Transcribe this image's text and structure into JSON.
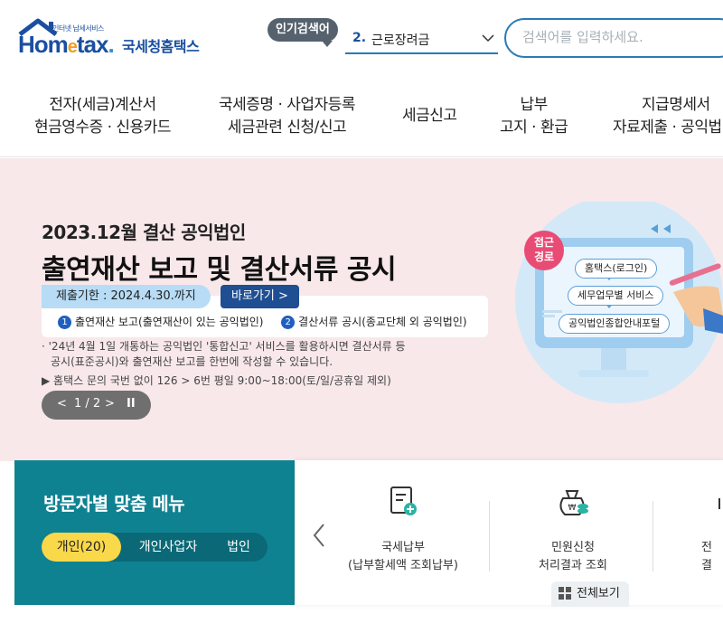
{
  "header": {
    "logo_small": "인터넷 납세서비스",
    "logo_main_1": "Hom",
    "logo_main_e": "e",
    "logo_main_2": "tax",
    "logo_kr": "국세청홈택스",
    "popular_label": "인기검색어",
    "popular_rank": "2.",
    "popular_keyword": "근로장려금",
    "search_placeholder": "검색어를 입력하세요."
  },
  "nav": [
    {
      "line1": "전자(세금)계산서",
      "line2": "현금영수증 · 신용카드"
    },
    {
      "line1": "국세증명 · 사업자등록",
      "line2": "세금관련 신청/신고"
    },
    {
      "line1": "세금신고",
      "line2": ""
    },
    {
      "line1": "납부",
      "line2": "고지 · 환급"
    },
    {
      "line1": "지급명세서",
      "line2": "자료제출 · 공익법"
    }
  ],
  "banner": {
    "subtitle": "2023.12월 결산 공익법인",
    "title": "출연재산 보고 및 결산서류 공시",
    "deadline": "제출기한 : 2024.4.30.까지",
    "go_button": "바로가기 >",
    "item1_num": "1",
    "item1": "출연재산 보고(출연재산이 있는 공익법인)",
    "item2_num": "2",
    "item2": "결산서류 공시(종교단체 외 공익법인)",
    "note_line1": "· '24년 4월 1일 개통하는 공익법인 '통합신고' 서비스를 활용하시면 결산서류 등",
    "note_line2": "  공시(표준공시)와 출연재산 보고를 한번에 작성할 수 있습니다.",
    "note_phone": "▶ 홈택스 문의 국번 없이 126 > 6번 평일 9:00~18:00(토/일/공휴일 제외)",
    "pager_prev": "<",
    "pager_text": "1 / 2",
    "pager_next": ">",
    "pager_pause": "II",
    "illus_badge_1": "접근",
    "illus_badge_2": "경로",
    "illus_step1": "홈택스(로그인)",
    "illus_step2": "세무업무별 서비스",
    "illus_step3": "공익법인종합안내포털"
  },
  "visitor": {
    "title": "방문자별 맞춤 메뉴",
    "tabs": [
      "개인(20)",
      "개인사업자",
      "법인"
    ],
    "active_tab": "개인(20)"
  },
  "quick": {
    "items": [
      {
        "line1": "국세납부",
        "line2": "(납부할세액 조회납부)",
        "icon": "tax-payment-document-icon"
      },
      {
        "line1": "민원신청",
        "line2": "처리결과 조회",
        "icon": "money-bag-coins-icon"
      },
      {
        "line1": "전",
        "line2": "결",
        "icon": "partial-icon"
      }
    ],
    "view_all": "전체보기"
  },
  "colors": {
    "brand_blue": "#1a4fa0",
    "banner_bg": "#f8e8ea",
    "visitor_bg": "#0f8292",
    "active_tab": "#f9d84a"
  }
}
